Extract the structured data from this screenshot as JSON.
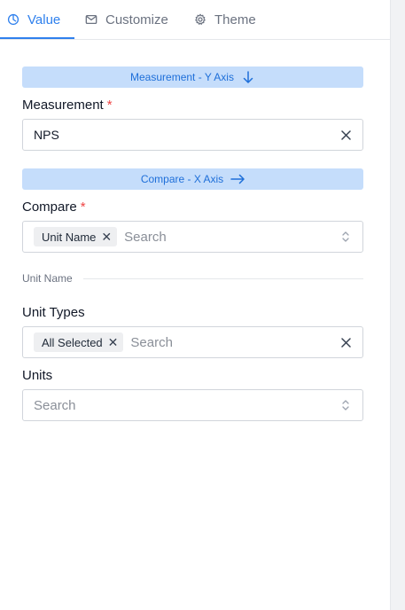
{
  "tabs": [
    {
      "label": "Value",
      "icon": "timer-icon",
      "active": true
    },
    {
      "label": "Customize",
      "icon": "envelope-icon",
      "active": false
    },
    {
      "label": "Theme",
      "icon": "gear-icon",
      "active": false
    }
  ],
  "measurement_banner": {
    "label": "Measurement - Y Axis",
    "icon": "arrow-down-icon"
  },
  "measurement": {
    "label": "Measurement",
    "required_mark": "*",
    "value": "NPS"
  },
  "compare_banner": {
    "label": "Compare - X Axis",
    "icon": "arrow-right-icon"
  },
  "compare": {
    "label": "Compare",
    "required_mark": "*",
    "tag": "Unit Name",
    "placeholder": "Search"
  },
  "section_divider": {
    "label": "Unit Name"
  },
  "unit_types": {
    "label": "Unit Types",
    "tag": "All Selected",
    "placeholder": "Search"
  },
  "units": {
    "label": "Units",
    "placeholder": "Search"
  },
  "colors": {
    "accent": "#2f80ed",
    "banner_bg": "#c5ddfb",
    "required": "#ef4444"
  }
}
